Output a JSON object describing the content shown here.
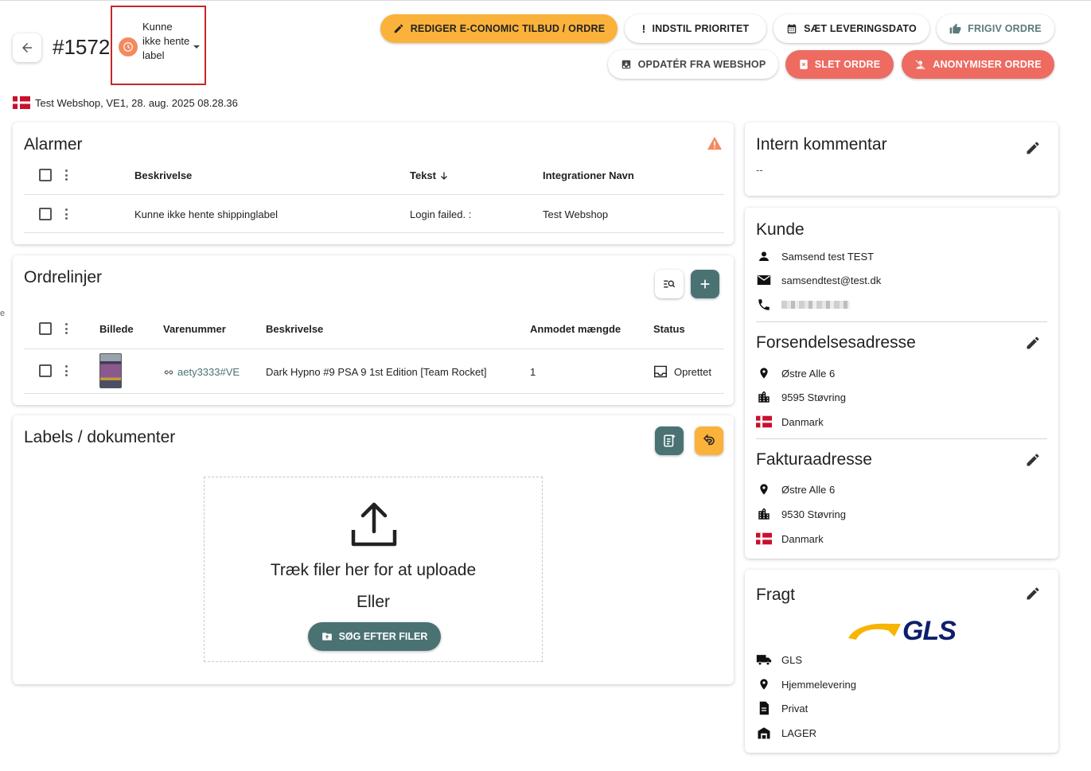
{
  "order": {
    "number": "#1572",
    "status_label": "Kunne ikke hente label",
    "meta": "Test Webshop, VE1, 28. aug. 2025 08.28.36"
  },
  "actions": {
    "edit_economic": "REDIGER E-CONOMIC TILBUD / ORDRE",
    "set_priority": "INDSTIL PRIORITET",
    "set_delivery_date": "SÆT LEVERINGSDATO",
    "release_order": "FRIGIV ORDRE",
    "update_from_webshop": "OPDATÉR FRA WEBSHOP",
    "delete_order": "SLET ORDRE",
    "anonymize_order": "ANONYMISER ORDRE"
  },
  "alarms": {
    "title": "Alarmer",
    "columns": {
      "description": "Beskrivelse",
      "text": "Tekst",
      "integration_name": "Integrationer Navn"
    },
    "rows": [
      {
        "description": "Kunne ikke hente shippinglabel",
        "text": "Login failed. :",
        "integration_name": "Test Webshop"
      }
    ]
  },
  "order_lines": {
    "title": "Ordrelinjer",
    "columns": {
      "image": "Billede",
      "sku": "Varenummer",
      "description": "Beskrivelse",
      "qty": "Anmodet mængde",
      "status": "Status"
    },
    "rows": [
      {
        "sku": "aety3333#VE",
        "description": "Dark Hypno #9 PSA 9 1st Edition [Team Rocket]",
        "qty": "1",
        "status": "Oprettet"
      }
    ]
  },
  "labels": {
    "title": "Labels / dokumenter",
    "drop_text": "Træk filer her for at uploade",
    "or_text": "Eller",
    "browse_label": "SØG EFTER FILER"
  },
  "internal_comment": {
    "title": "Intern kommentar",
    "value": "--"
  },
  "customer": {
    "title": "Kunde",
    "name": "Samsend test TEST",
    "email": "samsendtest@test.dk"
  },
  "shipping_address": {
    "title": "Forsendelsesadresse",
    "street": "Østre Alle 6",
    "city": "9595 Støvring",
    "country": "Danmark"
  },
  "billing_address": {
    "title": "Fakturaadresse",
    "street": "Østre Alle 6",
    "city": "9530 Støvring",
    "country": "Danmark"
  },
  "freight": {
    "title": "Fragt",
    "logo_text": "GLS",
    "carrier": "GLS",
    "delivery": "Hjemmelevering",
    "type": "Privat",
    "warehouse": "LAGER"
  },
  "edge_mark": "e",
  "colors": {
    "orange": "#fbb23b",
    "red": "#ee6b62",
    "teal": "#4b7273",
    "status_orange": "#f4895f",
    "highlight_border": "#c62828"
  }
}
